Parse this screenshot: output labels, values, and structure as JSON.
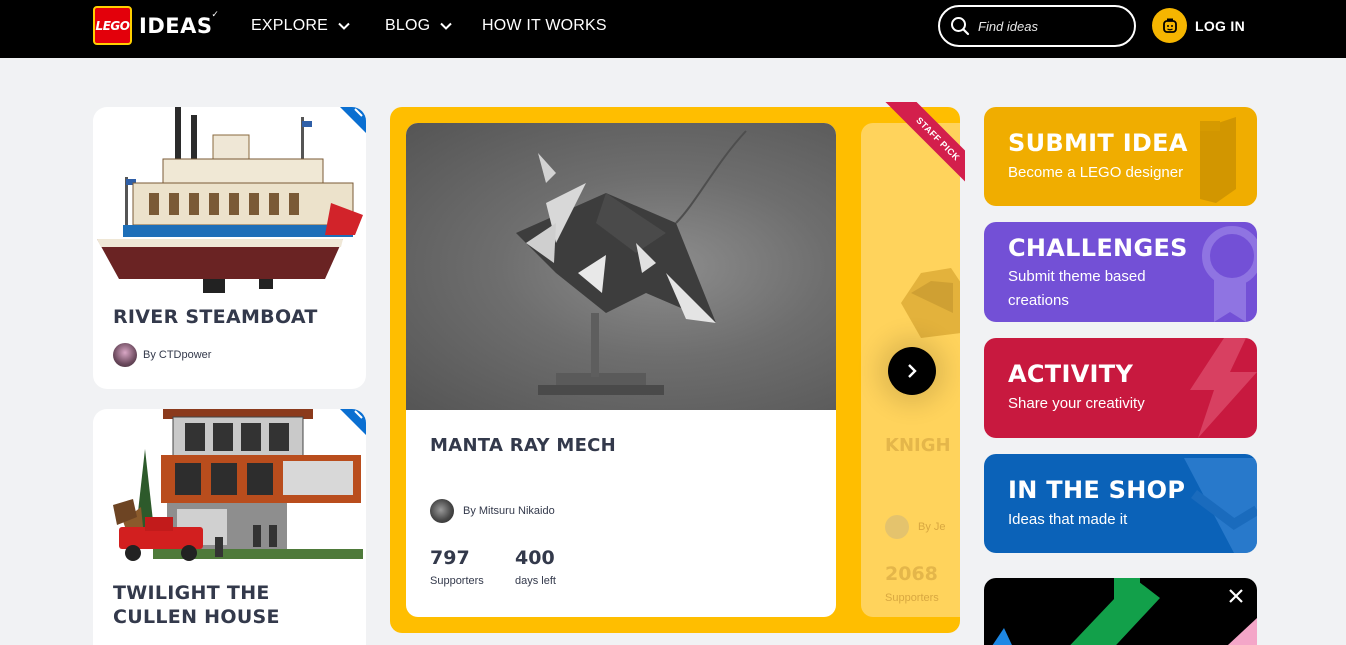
{
  "header": {
    "logo_badge": "LEGO",
    "logo_word": "IDEAS",
    "nav": [
      {
        "label": "EXPLORE"
      },
      {
        "label": "BLOG"
      },
      {
        "label": "HOW IT WORKS"
      }
    ],
    "search_placeholder": "Find ideas",
    "login_label": "LOG IN"
  },
  "left_cards": [
    {
      "title": "RIVER STEAMBOAT",
      "author": "By CTDpower"
    },
    {
      "title": "TWILIGHT THE CULLEN HOUSE"
    }
  ],
  "featured": {
    "title": "MANTA RAY MECH",
    "author": "By Mitsuru Nikaido",
    "supporters": "797",
    "supporters_label": "Supporters",
    "days": "400",
    "days_label": "days left",
    "badge": "STAFF PICK"
  },
  "peek_card": {
    "title": "KNIGH",
    "author": "By Je",
    "supporters": "2068",
    "supporters_label": "Supporters"
  },
  "tiles": [
    {
      "title": "SUBMIT IDEA",
      "subtitle": "Become a LEGO designer",
      "color": "#f0ad00"
    },
    {
      "title": "CHALLENGES",
      "subtitle": "Submit theme based creations",
      "color": "#7350d6"
    },
    {
      "title": "ACTIVITY",
      "subtitle": "Share your creativity",
      "color": "#c8193f"
    },
    {
      "title": "IN THE SHOP",
      "subtitle": "Ideas that made it",
      "color": "#0b62b8"
    }
  ],
  "colors": {
    "header_bg": "#000000",
    "page_bg": "#f1f2f4",
    "carousel_bg": "#ffbe00",
    "ribbon_blue": "#0a6fd1",
    "staff_pick_red": "#d31f4c",
    "text_dark": "#33394b"
  },
  "icons": [
    "chevron-down-icon",
    "search-icon",
    "minifig-icon",
    "ribbon-icon",
    "chevron-right-icon",
    "close-icon"
  ]
}
